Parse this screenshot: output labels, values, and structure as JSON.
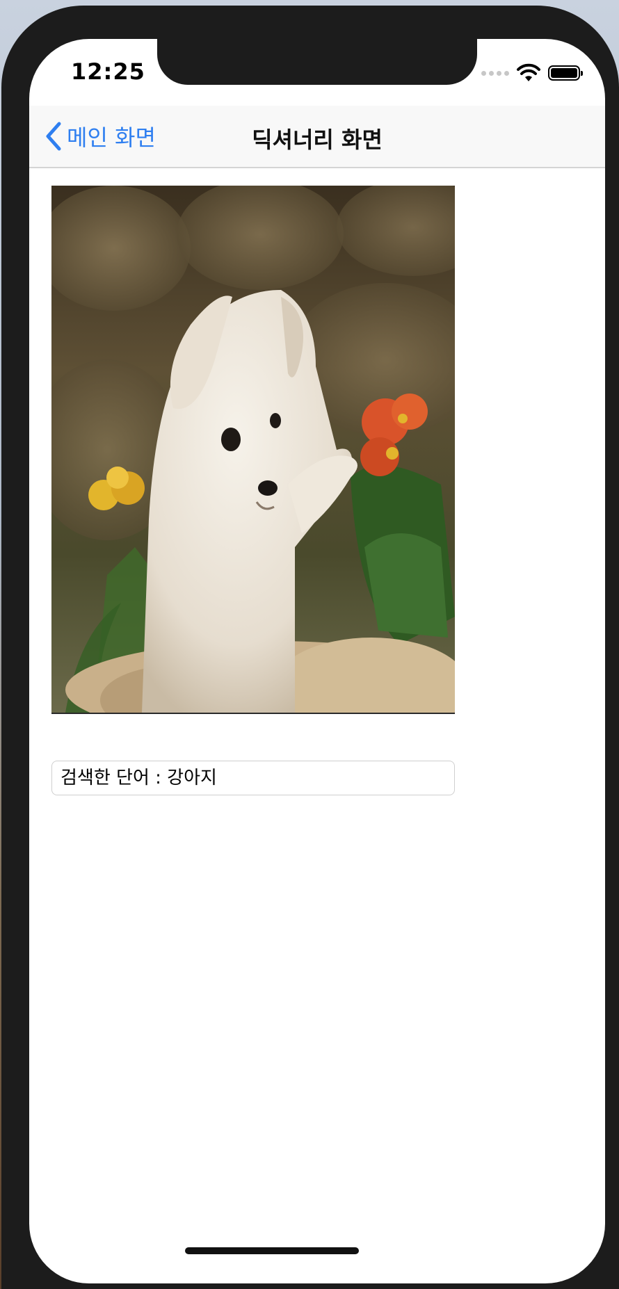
{
  "status_bar": {
    "time": "12:25"
  },
  "nav_bar": {
    "back_label": "메인 화면",
    "title": "딕셔너리 화면"
  },
  "content": {
    "image_subject": "puppy-photo",
    "search_text": "검색한 단어 : 강아지"
  },
  "colors": {
    "accent": "#2f7ff0",
    "device_frame": "#1c1c1c",
    "nav_background": "#f8f8f8"
  },
  "icons": {
    "back": "chevron-left-icon",
    "wifi": "wifi-icon",
    "battery": "battery-icon",
    "signal": "cellular-signal-icon"
  }
}
